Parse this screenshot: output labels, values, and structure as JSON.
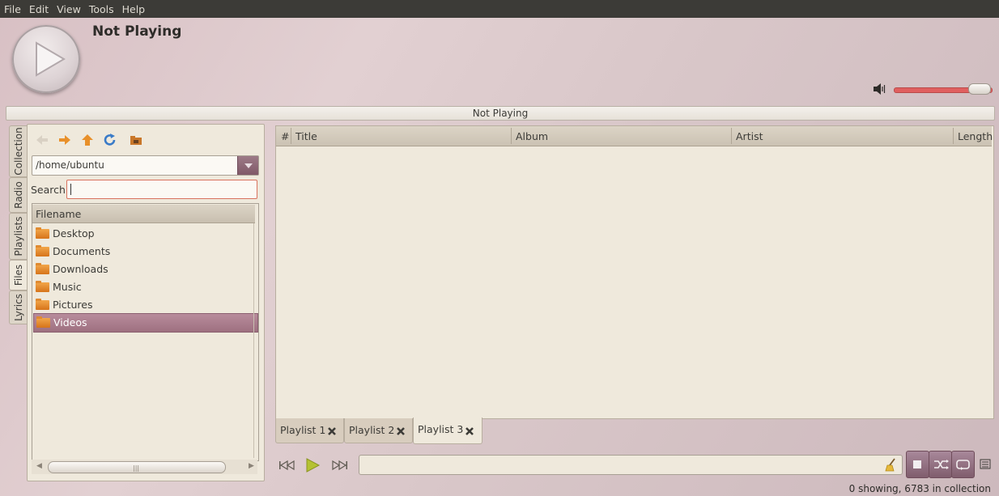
{
  "menu": [
    "File",
    "Edit",
    "View",
    "Tools",
    "Help"
  ],
  "now_playing": {
    "title": "Not Playing",
    "progress_text": "Not Playing"
  },
  "volume": {
    "level": 0.9
  },
  "side_tabs": [
    "Collection",
    "Radio",
    "Playlists",
    "Files",
    "Lyrics"
  ],
  "files": {
    "path": "/home/ubuntu",
    "search_label": "Search:",
    "search_value": "",
    "column": "Filename",
    "items": [
      "Desktop",
      "Documents",
      "Downloads",
      "Music",
      "Pictures",
      "Videos"
    ],
    "selected": "Videos"
  },
  "playlist": {
    "columns": [
      "#",
      "Title",
      "Album",
      "Artist",
      "Length"
    ],
    "tabs": [
      "Playlist 1",
      "Playlist 2",
      "Playlist 3"
    ],
    "active_tab": "Playlist 3"
  },
  "filter_value": "",
  "status": "0 showing, 6783 in collection"
}
